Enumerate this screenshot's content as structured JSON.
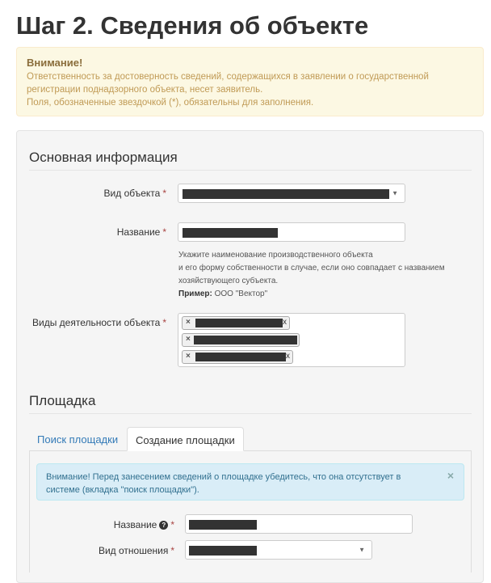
{
  "page": {
    "title": "Шаг 2. Сведения об объекте"
  },
  "warning": {
    "title": "Внимание!",
    "line1": "Ответственность за достоверность сведений, содержащихся в заявлении о государственной",
    "line2": "регистрации поднадзорного объекта, несет заявитель.",
    "line3": "Поля, обозначенные звездочкой (*), обязательны для заполнения."
  },
  "basic": {
    "legend": "Основная информация",
    "object_type_label": "Вид объекта",
    "name_label": "Название",
    "required_mark": "*",
    "help_line1": "Укажите наименование производственного объекта",
    "help_line2": "и его форму собственности в случае, если оно совпадает с названием",
    "help_line3": "хозяйствующего субъекта.",
    "example_label": "Пример:",
    "example_value": "ООО \"Вектор\"",
    "activities_label": "Виды деятельности объекта",
    "tag_remove": "×",
    "tag_tail_1": "х",
    "tag_tail_3": "х"
  },
  "site": {
    "legend": "Площадка",
    "tab_search": "Поиск площадки",
    "tab_create": "Создание площадки",
    "info_text": "Внимание! Перед занесением сведений о площадке убедитесь, что она отсутствует в системе (вкладка \"поиск площадки\").",
    "info_close": "×",
    "name_label": "Название",
    "help_icon": "?",
    "relation_label": "Вид отношения",
    "caret": "▼"
  },
  "colors": {
    "warning_bg": "#fcf8e3",
    "warning_text": "#c09a55",
    "info_bg": "#d9edf7",
    "info_text": "#31708f",
    "link": "#337ab7",
    "required": "#a94442"
  },
  "icons": [
    "question-circle-icon",
    "close-icon",
    "chevron-down-icon",
    "remove-tag-icon"
  ]
}
